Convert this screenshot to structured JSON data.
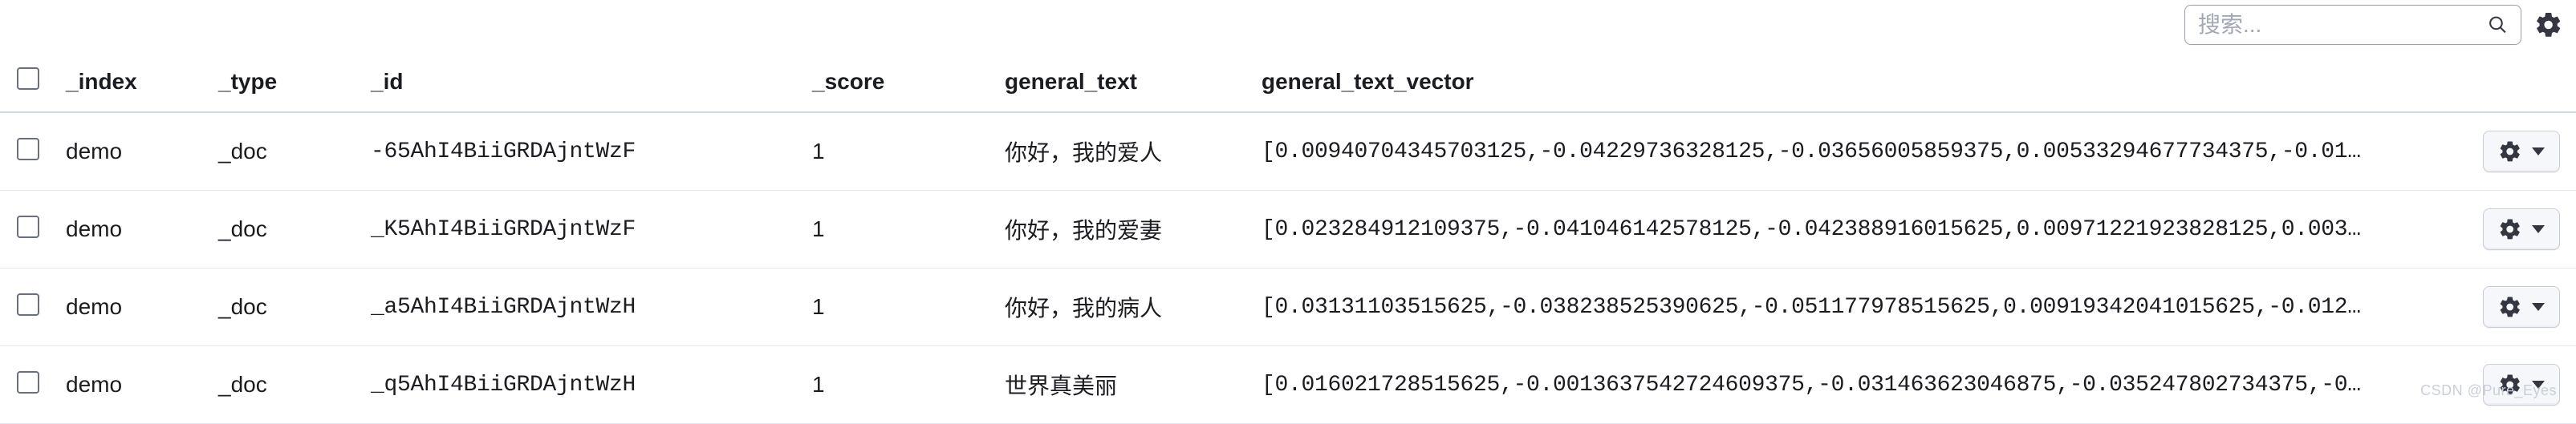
{
  "search": {
    "placeholder": "搜索..."
  },
  "columns": {
    "index": "_index",
    "type": "_type",
    "id": "_id",
    "score": "_score",
    "general_text": "general_text",
    "general_text_vector": "general_text_vector"
  },
  "rows": [
    {
      "index": "demo",
      "type": "_doc",
      "id": "-65AhI4BiiGRDAjntWzF",
      "score": "1",
      "general_text": "你好，我的爱人",
      "vector": "[0.00940704345703125,-0.04229736328125,-0.03656005859375,0.00533294677734375,-0.01…"
    },
    {
      "index": "demo",
      "type": "_doc",
      "id": "_K5AhI4BiiGRDAjntWzF",
      "score": "1",
      "general_text": "你好，我的爱妻",
      "vector": "[0.023284912109375,-0.041046142578125,-0.042388916015625,0.00971221923828125,0.003…"
    },
    {
      "index": "demo",
      "type": "_doc",
      "id": "_a5AhI4BiiGRDAjntWzH",
      "score": "1",
      "general_text": "你好，我的病人",
      "vector": "[0.03131103515625,-0.038238525390625,-0.051177978515625,0.00919342041015625,-0.012…"
    },
    {
      "index": "demo",
      "type": "_doc",
      "id": "_q5AhI4BiiGRDAjntWzH",
      "score": "1",
      "general_text": "世界真美丽",
      "vector": "[0.016021728515625,-0.0013637542724609375,-0.031463623046875,-0.035247802734375,-0…"
    }
  ],
  "watermark": "CSDN @Pure_Eyes"
}
